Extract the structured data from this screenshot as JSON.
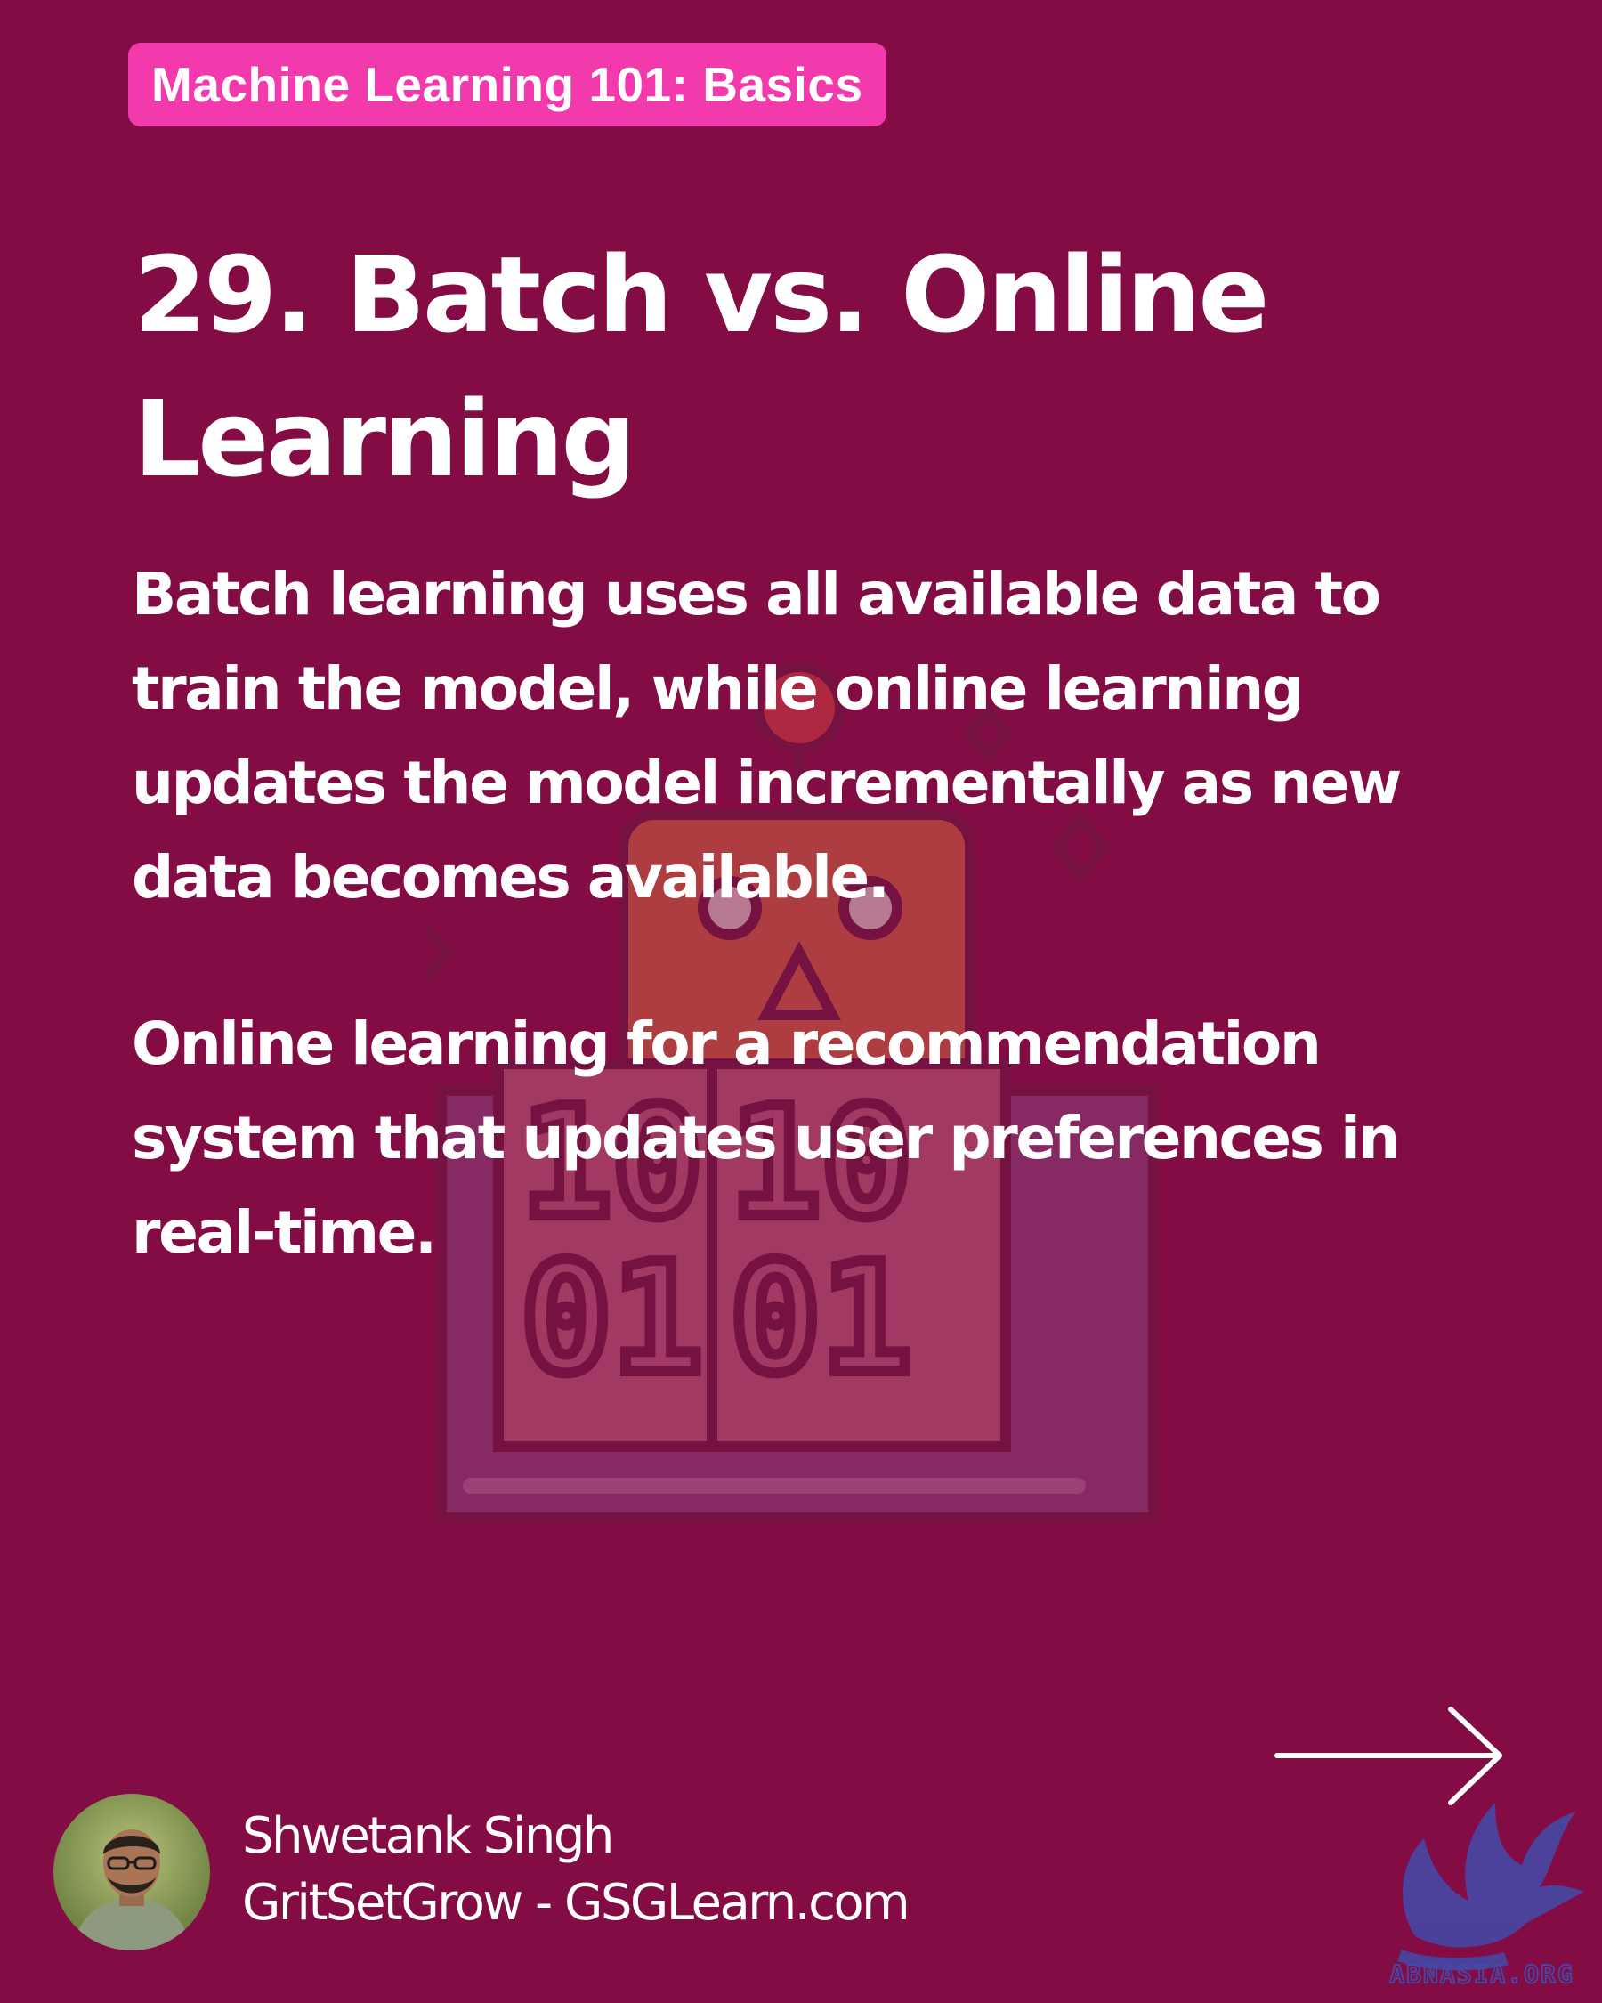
{
  "series_badge": "Machine Learning 101: Basics",
  "title": "29. Batch vs. Online Learning",
  "paragraphs": [
    "Batch learning uses all available data to train the model, while online learning updates the model incrementally as new data becomes available.",
    "Online learning for a recommendation system that updates user preferences in real-time."
  ],
  "author": {
    "name": "Shwetank Singh",
    "site": "GritSetGrow - GSGLearn.com"
  },
  "watermark_text": "ABNASIA.ORG",
  "illustration_digits": [
    "10",
    "10",
    "01",
    "01"
  ],
  "icons": {
    "next": "arrow-right-icon",
    "illustration": "robot-learning-book-icon",
    "watermark": "griffin-logo-icon"
  },
  "colors": {
    "background": "#830c45",
    "badge": "#f23aac",
    "text": "#ffffff"
  }
}
